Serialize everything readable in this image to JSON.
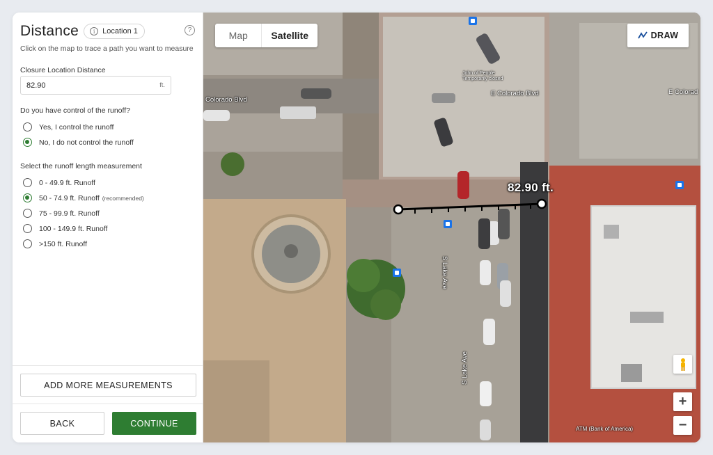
{
  "panel": {
    "title": "Distance",
    "location_pill": "Location 1",
    "subtitle": "Click on the map to trace a path you want to measure",
    "distance_label": "Closure Location Distance",
    "distance_value": "82.90",
    "distance_unit": "ft.",
    "control_question": "Do you have control of the runoff?",
    "control_options": [
      {
        "label": "Yes, I control the runoff",
        "selected": false
      },
      {
        "label": "No, I do not control the runoff",
        "selected": true
      }
    ],
    "runoff_question": "Select the runoff length measurement",
    "runoff_options": [
      {
        "label": "0 - 49.9 ft. Runoff",
        "note": "",
        "selected": false
      },
      {
        "label": "50 - 74.9 ft. Runoff",
        "note": "(recommended)",
        "selected": true
      },
      {
        "label": "75 - 99.9 ft. Runoff",
        "note": "",
        "selected": false
      },
      {
        "label": "100 - 149.9 ft. Runoff",
        "note": "",
        "selected": false
      },
      {
        "label": ">150 ft. Runoff",
        "note": "",
        "selected": false
      }
    ],
    "add_more_label": "ADD MORE MEASUREMENTS",
    "back_label": "BACK",
    "continue_label": "CONTINUE",
    "help_icon": "?"
  },
  "map": {
    "tabs": {
      "map": "Map",
      "satellite": "Satellite"
    },
    "active_tab": "satellite",
    "draw_label": "DRAW",
    "measurement_label": "82.90 ft.",
    "street_labels": {
      "colorado_left": "Colorado Blvd",
      "colorado_center": "E Colorado Blvd",
      "colorado_right": "E Colorad",
      "lake_upper": "S Lake Ave",
      "lake_lower": "S Lake Ave",
      "poi": "John of People Temporarily closed",
      "atm": "ATM (Bank of America)"
    },
    "zoom_in": "+",
    "zoom_out": "−",
    "colors": {
      "accent_green": "#2e7d32",
      "transit_blue": "#1a73e8"
    }
  }
}
